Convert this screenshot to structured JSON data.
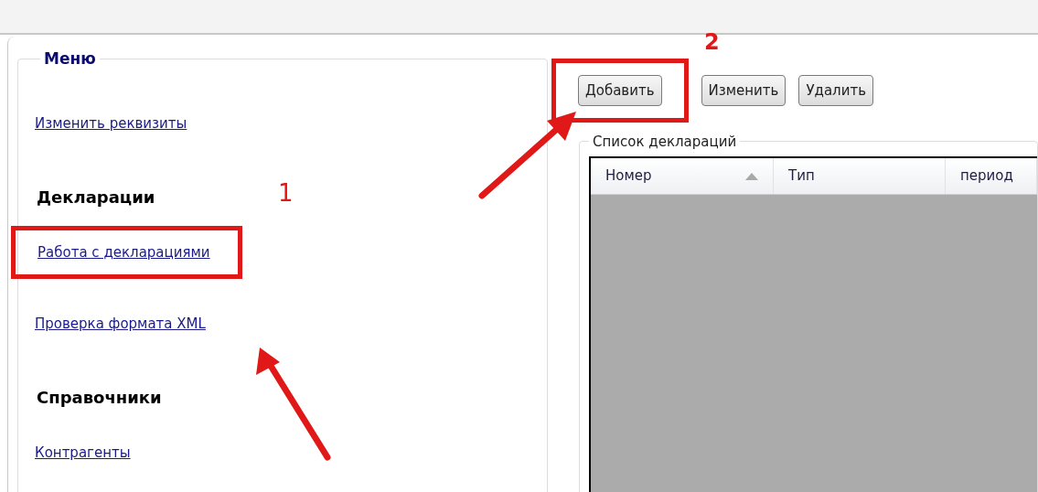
{
  "menu": {
    "title": "Меню",
    "sections": [
      {
        "kind": "link",
        "label": "Изменить реквизиты",
        "highlighted": false
      },
      {
        "kind": "heading",
        "label": "Декларации"
      },
      {
        "kind": "link",
        "label": "Работа с декларациями",
        "highlighted": true
      },
      {
        "kind": "link",
        "label": "Проверка формата XML",
        "highlighted": false
      },
      {
        "kind": "heading",
        "label": "Справочники"
      },
      {
        "kind": "link",
        "label": "Контрагенты",
        "highlighted": false
      }
    ]
  },
  "toolbar": {
    "buttons": [
      {
        "label": "Добавить",
        "highlighted": true
      },
      {
        "label": "Изменить",
        "highlighted": false
      },
      {
        "label": "Удалить",
        "highlighted": false
      }
    ]
  },
  "declarations": {
    "title": "Список деклараций",
    "columns": [
      {
        "label": "Номер",
        "sorted": true
      },
      {
        "label": "Тип",
        "sorted": false
      },
      {
        "label": "период",
        "sorted": false
      }
    ]
  },
  "annotations": [
    {
      "label": "1"
    },
    {
      "label": "2"
    }
  ]
}
